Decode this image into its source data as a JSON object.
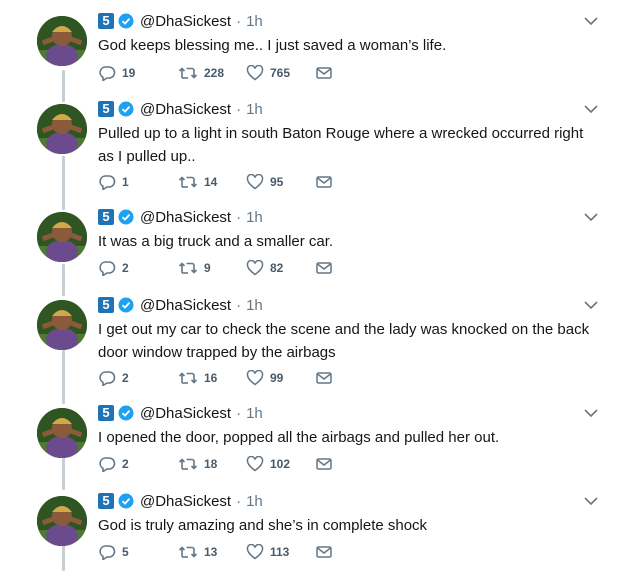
{
  "account": {
    "badge": "5",
    "handle": "@DhaSickest",
    "separator": "·"
  },
  "tweets": [
    {
      "time": "1h",
      "text": "God keeps blessing me.. I just saved a  woman’s life.",
      "replies": "19",
      "retweets": "228",
      "likes": "765"
    },
    {
      "time": "1h",
      "text": "Pulled up to a light in south Baton Rouge where a wrecked occurred right as I pulled up..",
      "replies": "1",
      "retweets": "14",
      "likes": "95"
    },
    {
      "time": "1h",
      "text": "It was a big truck and a smaller car.",
      "replies": "2",
      "retweets": "9",
      "likes": "82"
    },
    {
      "time": "1h",
      "text": "I get out my car to check the scene and the lady was knocked on the back door window trapped by the airbags",
      "replies": "2",
      "retweets": "16",
      "likes": "99"
    },
    {
      "time": "1h",
      "text": "I opened the door, popped all the airbags and pulled her out.",
      "replies": "2",
      "retweets": "18",
      "likes": "102"
    },
    {
      "time": "1h",
      "text": "God is truly amazing and she’s in complete shock",
      "replies": "5",
      "retweets": "13",
      "likes": "113"
    }
  ],
  "icons": {
    "verified": "verified-badge-icon",
    "reply": "reply-icon",
    "retweet": "retweet-icon",
    "like": "heart-icon",
    "dm": "direct-message-icon",
    "caret": "chevron-down-icon"
  },
  "colors": {
    "verified": "#1da1f2",
    "badge": "#1f73b7",
    "thread_line": "#c4cfd6",
    "meta": "#657786"
  }
}
